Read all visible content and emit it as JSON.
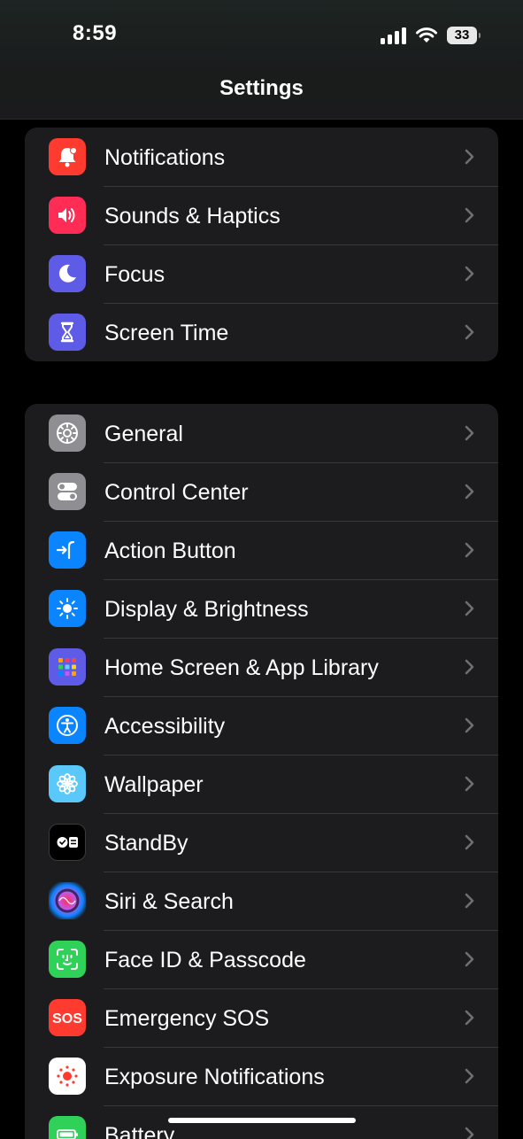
{
  "status_bar": {
    "time": "8:59",
    "battery_level": "33",
    "signal_bars": 4,
    "wifi": true
  },
  "header": {
    "title": "Settings"
  },
  "groups": [
    {
      "items": [
        {
          "label": "Notifications",
          "icon": "notifications-icon",
          "color": "#ff3b30"
        },
        {
          "label": "Sounds & Haptics",
          "icon": "speaker-icon",
          "color": "#ff2d55"
        },
        {
          "label": "Focus",
          "icon": "moon-icon",
          "color": "#5e5ce6"
        },
        {
          "label": "Screen Time",
          "icon": "hourglass-icon",
          "color": "#5e5ce6"
        }
      ]
    },
    {
      "items": [
        {
          "label": "General",
          "icon": "gear-icon",
          "color": "#8e8e93"
        },
        {
          "label": "Control Center",
          "icon": "toggles-icon",
          "color": "#8e8e93"
        },
        {
          "label": "Action Button",
          "icon": "action-button-icon",
          "color": "#0a84ff"
        },
        {
          "label": "Display & Brightness",
          "icon": "sun-icon",
          "color": "#0a84ff"
        },
        {
          "label": "Home Screen & App Library",
          "icon": "app-grid-icon",
          "color": "#5e5ce6"
        },
        {
          "label": "Accessibility",
          "icon": "accessibility-icon",
          "color": "#0a84ff"
        },
        {
          "label": "Wallpaper",
          "icon": "flower-icon",
          "color": "#5ac8fa"
        },
        {
          "label": "StandBy",
          "icon": "standby-icon",
          "color": "#000000"
        },
        {
          "label": "Siri & Search",
          "icon": "siri-icon",
          "color": "#1c1c1e"
        },
        {
          "label": "Face ID & Passcode",
          "icon": "face-id-icon",
          "color": "#30d158"
        },
        {
          "label": "Emergency SOS",
          "icon": "sos-icon",
          "color": "#ff3b30"
        },
        {
          "label": "Exposure Notifications",
          "icon": "exposure-icon",
          "color": "#ffffff"
        },
        {
          "label": "Battery",
          "icon": "battery-icon",
          "color": "#30d158"
        }
      ]
    }
  ]
}
